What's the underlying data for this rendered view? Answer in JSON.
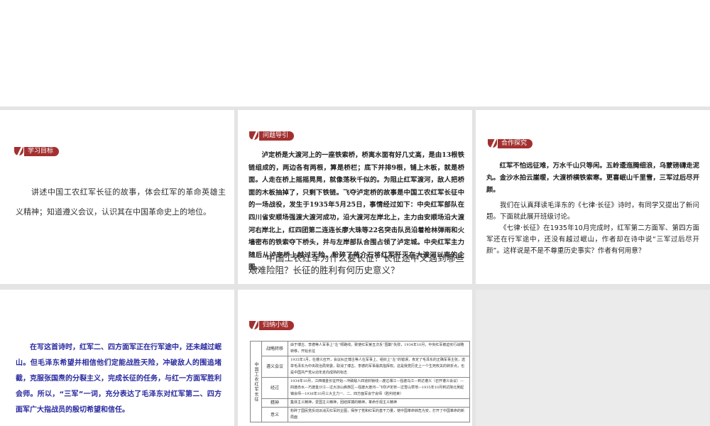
{
  "panel1": {
    "badge": "学习目标",
    "text": "讲述中国工农红军长征的故事，体会红军的革命英雄主义精神；知道遵义会议，认识其在中国革命史上的地位。"
  },
  "panel2": {
    "badge": "问题导引",
    "text": "泸定桥是大渡河上的一座铁索桥，桥离水面有好几丈高，是由13根铁链组成的，两边各有两根，算是桥栏；底下并排9根，铺上木板，就是桥面。人走在桥上摇摇晃晃，就像荡秋千似的。为阻止红军渡河，敌人把桥面的木板抽掉了，只剩下铁链。飞夺泸定桥的故事是中国工农红军长征中的一场战役，发生于1935年5月25日，事情经过如下：中央红军部队在四川省安顺场强渡大渡河成功，沿大渡河左岸北上，主力由安顺场沿大渡河右岸北上，红四团第二连连长廖大珠等22名突击队员沿着枪林弹雨和火墙密布的铁索夺下桥头，并与左岸部队合围占领了泸定城。中央红军主力随后从泸定桥上越过天险，粉碎了蒋介石将红军歼灭在大渡河以南的企图。",
    "question": "中国工农红军为什么要长征？长征途中又遇到哪些艰难险阻？长征的胜利有何历史意义？"
  },
  "panel3": {
    "badge": "合作探究",
    "poem": "红军不怕远征难，万水千山只等闲。五岭逶迤腾细浪，乌蒙磅礴走泥丸。金沙水拍云崖暖，大渡桥横铁索寒。更喜岷山千里雪，三军过后尽开颜。",
    "p1": "我们在认真拜读毛泽东的《七律·长征》诗时，有同学又提出了新问题。下面就此展开班级讨论。",
    "p2": "《七律·长征》在1935年10月完成时，红军第二方面军、第四方面军还在行军途中，还没有越过岷山，作者却在诗中说“三军过后尽开颜”。这样说是不是不尊重历史事实？作者有何用意？"
  },
  "panel4": {
    "text": "在写这首诗时，红军二、四方面军正在行军途中，还未越过岷山。但毛泽东希望并相信他们定能战胜天险，冲破敌人的围追堵截，克服张国焘的分裂主义，完成长征的任务，与红一方面军胜利会师。所以，“三军”一词，充分表达了毛泽东对红军第二、四方面军广大指战员的殷切希望和信任。"
  },
  "panel5": {
    "badge": "归纳小结",
    "side": "中国工农红军长征",
    "rows": [
      {
        "h": "战略转移",
        "c": "由于博古、李德等人军事上“左”倾路线，致使红军第五次反“围剿”失败，1934年10月，中央红军被迫实行战略转移，开始长征"
      },
      {
        "h": "遵义会议",
        "c": "1935年1月，在遵义召开，会议纠正博古等人在军事上、组织上“左”的错误，肯定了毛泽东的正确军事主张，选举毛泽东为中央政治局常委，取消了博古、李德的军事最高指挥权。这是我党历史上一个生死攸关的转折点，也是中国共产党从幼年走向成熟的标志"
      },
      {
        "h": "经过",
        "c": "1934年10月，江西瑞金长征开始—冲破敌人四道封锁线—渡过湘江—强渡乌江—到达遵义（召开遵义会议）—四渡赤水—巧渡金沙江—过大凉山彝族区—强渡大渡河—飞夺泸定桥—过雪山草地—1935年10月到达陕北吴起镇会师—1936年10月三大主力一、二、四方面军会宁会师（胜利结束）"
      },
      {
        "h": "精神",
        "c": "集体主义精神，爱国主义精神，团结拼搏的精神，革命乐观主义精神"
      },
      {
        "h": "意义",
        "c": "粉碎了国民党反动派消灭红军的企图，保存了党和红军的基干力量，使中国革命转危为安，打开了中国革命的新局面"
      }
    ]
  },
  "colors": {
    "badge": "#a33030",
    "answer": "#2a2aa0"
  }
}
